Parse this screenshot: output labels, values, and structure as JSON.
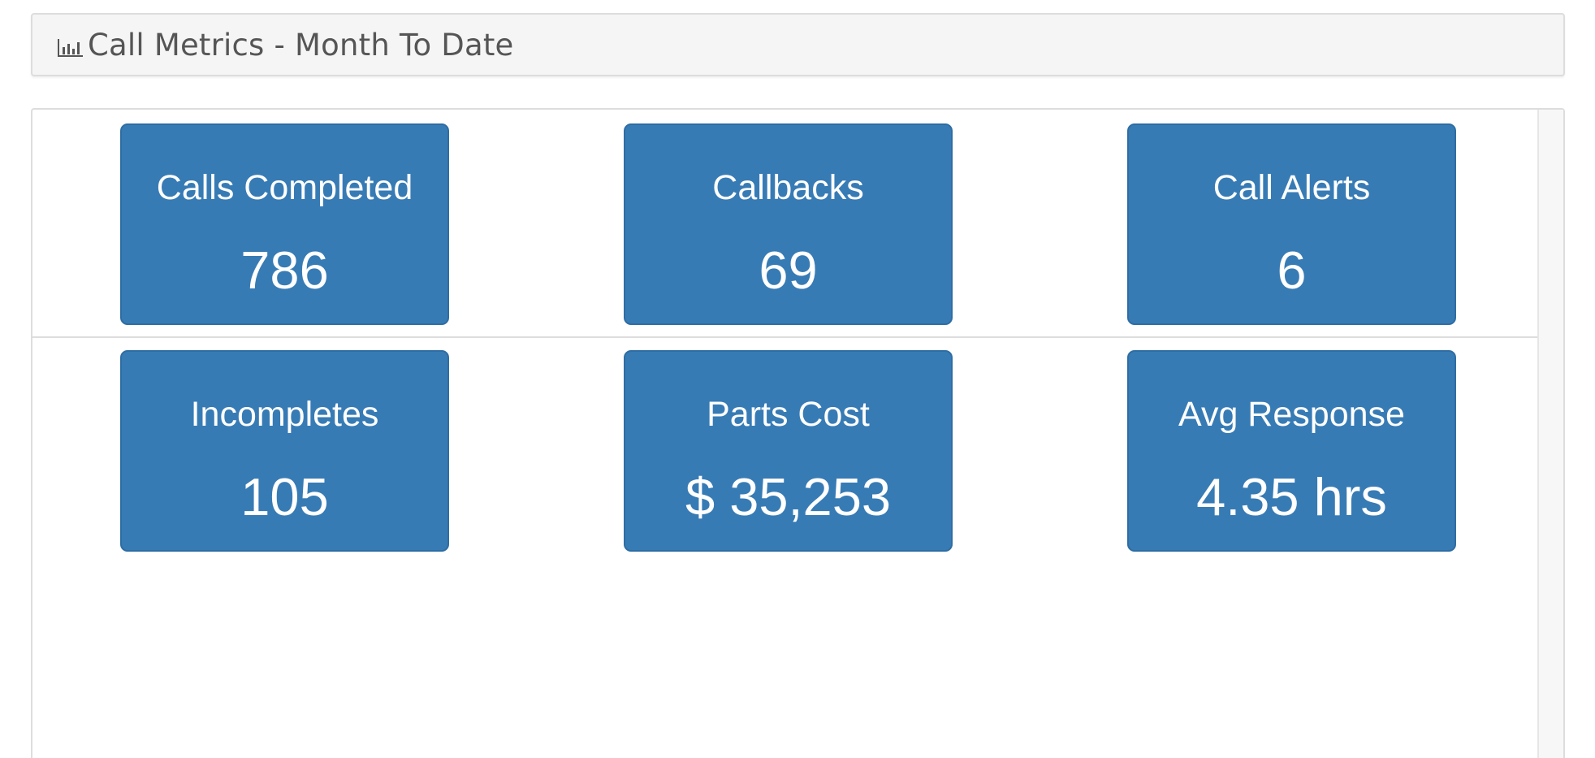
{
  "panel": {
    "title": "Call Metrics - Month To Date",
    "icon": "bar-chart-icon"
  },
  "colors": {
    "tile_background": "#377bb5",
    "tile_border": "#2e6da4",
    "heading_background": "#f5f5f5",
    "heading_text": "#555555"
  },
  "metrics": [
    {
      "label": "Calls Completed",
      "value": "786"
    },
    {
      "label": "Callbacks",
      "value": "69"
    },
    {
      "label": "Call Alerts",
      "value": "6"
    },
    {
      "label": "Incompletes",
      "value": "105"
    },
    {
      "label": "Parts Cost",
      "value": "$ 35,253"
    },
    {
      "label": "Avg Response",
      "value": "4.35 hrs"
    }
  ]
}
